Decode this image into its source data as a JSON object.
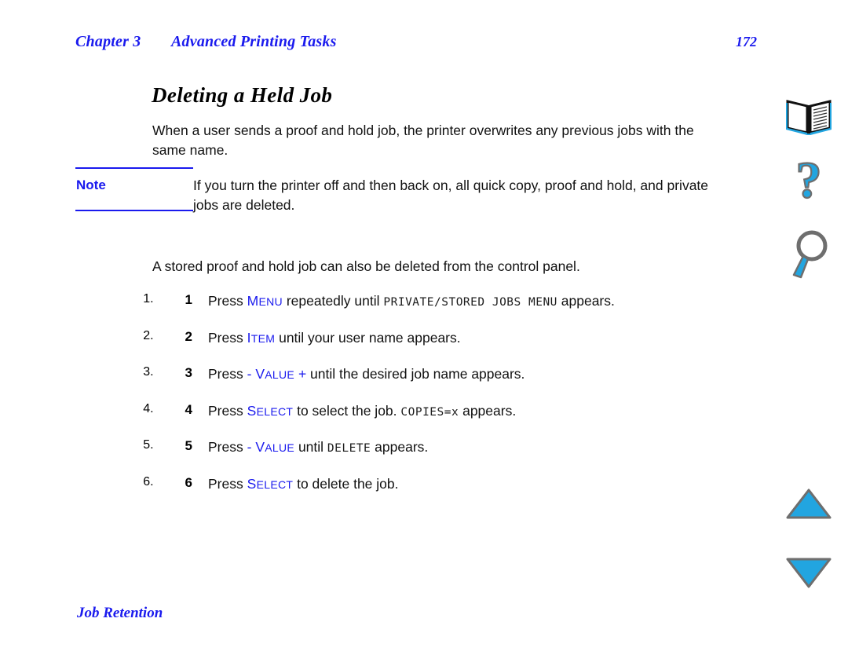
{
  "header": {
    "chapter": "Chapter 3",
    "chapter_title": "Advanced Printing Tasks",
    "page_number": "172"
  },
  "section": {
    "title": "Deleting a Held Job"
  },
  "intro_paragraph": "When a user sends a proof and hold job, the printer overwrites any previous jobs with the same name.",
  "note": {
    "label": "Note",
    "body": "If you turn the printer off and then back on, all quick copy, proof and hold, and private jobs are deleted."
  },
  "control_panel_paragraph": "A stored proof and hold job can also be deleted from the control panel.",
  "steps": [
    {
      "number": "1",
      "lead": "Press ",
      "key_cap": "M",
      "key_rest": "ENU",
      "mid": " repeatedly until ",
      "lcd": "PRIVATE/STORED JOBS MENU",
      "tail": " appears."
    },
    {
      "number": "2",
      "lead": "Press ",
      "key_cap": "I",
      "key_rest": "TEM",
      "mid": " until your user name appears.",
      "lcd": "",
      "tail": ""
    },
    {
      "number": "3",
      "lead": "Press ",
      "prefix_sign": "-",
      "key_cap": "V",
      "key_rest": "ALUE",
      "suffix_sign": "+",
      "mid": " until the desired job name appears.",
      "lcd": "",
      "tail": ""
    },
    {
      "number": "4",
      "lead": "Press ",
      "key_cap": "S",
      "key_rest": "ELECT",
      "mid": " to select the job. ",
      "lcd": "COPIES=x",
      "tail": " appears."
    },
    {
      "number": "5",
      "lead": "Press ",
      "prefix_sign": "-",
      "key_cap": "V",
      "key_rest": "ALUE",
      "mid": " until ",
      "lcd": "DELETE",
      "tail": " appears."
    },
    {
      "number": "6",
      "lead": "Press ",
      "key_cap": "S",
      "key_rest": "ELECT",
      "mid": " to delete the job.",
      "lcd": "",
      "tail": ""
    }
  ],
  "footer": {
    "text": "Job Retention"
  },
  "sidebar": {
    "icons": [
      {
        "name": "book-icon",
        "title": "Table of contents"
      },
      {
        "name": "question-mark-icon",
        "title": "Help"
      },
      {
        "name": "magnifier-icon",
        "title": "Search"
      },
      {
        "name": "triangle-up-icon",
        "title": "Previous page"
      },
      {
        "name": "triangle-down-icon",
        "title": "Next page"
      }
    ]
  },
  "colors": {
    "accent_blue": "#1a1aee",
    "icon_cyan": "#22a5e0",
    "icon_shadow": "#6e6e6e",
    "text_black": "#111111"
  }
}
